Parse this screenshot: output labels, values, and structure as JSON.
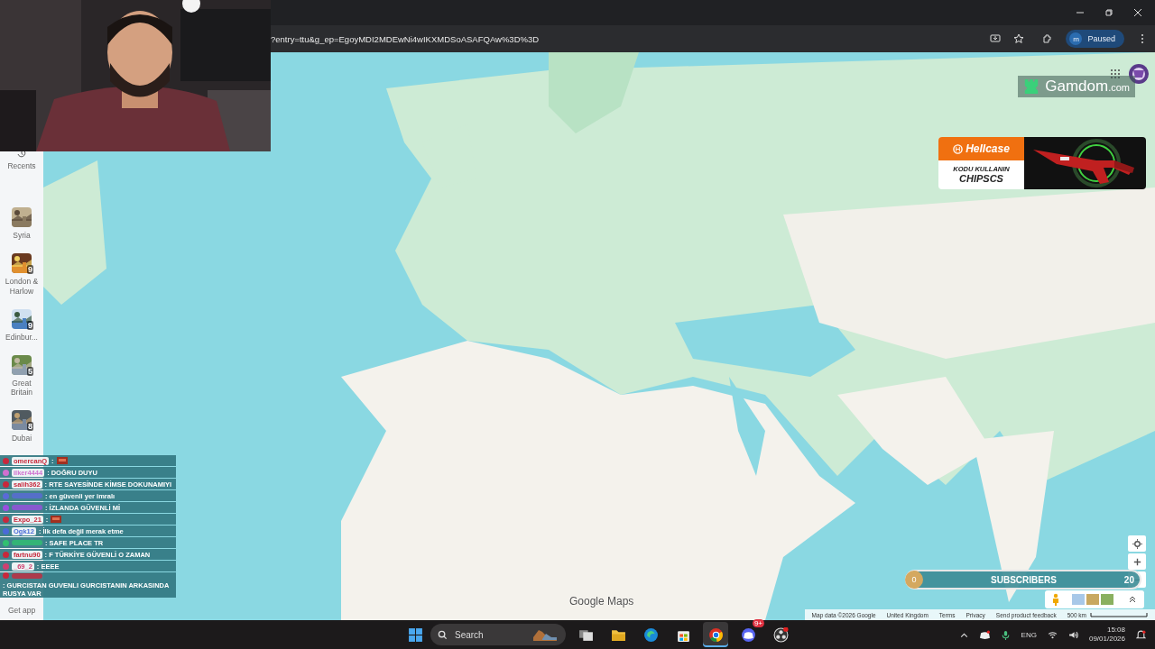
{
  "browser": {
    "url": "?entry=ttu&g_ep=EgoyMDI2MDEwNi4wIKXMDSoASAFQAw%3D%3D",
    "profile": {
      "initial": "m",
      "label": "Paused"
    }
  },
  "sidebar": {
    "recents": "Recents",
    "items": [
      {
        "label": "Syria"
      },
      {
        "label": "London & Harlow",
        "count": "9"
      },
      {
        "label": "Edinbur...",
        "count": "9"
      },
      {
        "label": "Great Britain",
        "count": "5"
      },
      {
        "label": "Dubai",
        "count": "8"
      }
    ],
    "get_app": "Get app"
  },
  "ads": {
    "gamdom": {
      "name": "Gamdom",
      "suffix": ".com"
    },
    "hellcase": {
      "brand": "Hellcase",
      "prompt": "KODU KULLANIN",
      "code": "CHIPSCS"
    }
  },
  "chat": [
    {
      "kind": "emote",
      "user": "omercanQ",
      "color": "#c8283c",
      "text": ":"
    },
    {
      "kind": "text",
      "user": "ilker4444",
      "color": "#d070d0",
      "text": ": DOĞRU DUYU"
    },
    {
      "kind": "text",
      "user": "salih362",
      "color": "#c8283c",
      "text": ": RTE SAYESİNDE KİMSE DOKUNAMIYI"
    },
    {
      "kind": "text",
      "color": "#5a6ad8",
      "text": ": en güvenli yer imralı"
    },
    {
      "kind": "text",
      "color": "#9a50e0",
      "text": ": İZLANDA GÜVENLİ Mİ"
    },
    {
      "kind": "emote",
      "user": "Expo_21",
      "color": "#c8283c",
      "text": ":"
    },
    {
      "kind": "text",
      "user": "Ogk12",
      "color": "#4a6ad8",
      "text": ": İlk defa değil merak etme"
    },
    {
      "kind": "text",
      "color": "#30c070",
      "text": ": SAFE PLACE TR"
    },
    {
      "kind": "text",
      "user": "fartnu90",
      "color": "#c8283c",
      "text": ": F TÜRKİYE GÜVENLİ O ZAMAN"
    },
    {
      "kind": "text",
      "user": "_69_2",
      "color": "#d04070",
      "text": ": EEEE"
    },
    {
      "kind": "text",
      "color": "#c8283c",
      "text": ": GURCISTAN GUVENLI GURCISTANIN ARKASINDA RUSYA VAR"
    }
  ],
  "subscribers": {
    "current": "0",
    "label": "SUBSCRIBERS",
    "goal": "20"
  },
  "map": {
    "logo": "Google Maps",
    "footer": [
      "Map data ©2026 Google",
      "United Kingdom",
      "Terms",
      "Privacy",
      "Send product feedback"
    ],
    "scale": "500 km"
  },
  "taskbar": {
    "search": "Search",
    "apps": [
      {
        "kind": "taskview",
        "selected": false
      },
      {
        "kind": "folder",
        "selected": false
      },
      {
        "kind": "edge",
        "selected": false
      },
      {
        "kind": "store",
        "selected": false
      },
      {
        "kind": "chrome",
        "selected": true
      },
      {
        "kind": "discord",
        "selected": false,
        "badge": "9+"
      },
      {
        "kind": "obs",
        "selected": false
      }
    ],
    "language": "ENG",
    "time": "15:08",
    "date": "09/01/2026"
  }
}
